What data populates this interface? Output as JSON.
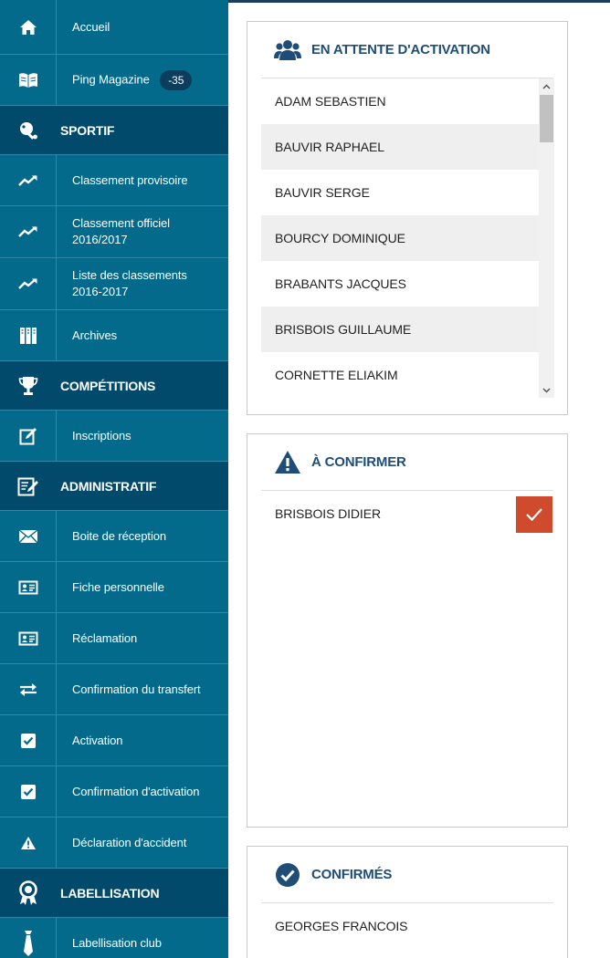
{
  "sidebar": {
    "items": [
      {
        "label": "Accueil",
        "icon": "home-icon"
      },
      {
        "label": "Ping Magazine",
        "badge": "-35",
        "icon": "book-icon"
      },
      {
        "section": "SPORTIF",
        "icon": "pingpong-icon"
      },
      {
        "label": "Classement provisoire",
        "icon": "trend-icon"
      },
      {
        "label": "Classement officiel 2016/2017",
        "icon": "trend-icon"
      },
      {
        "label": "Liste des classements 2016-2017",
        "icon": "trend-icon"
      },
      {
        "label": "Archives",
        "icon": "archive-icon"
      },
      {
        "section": "COMPÉTITIONS",
        "icon": "trophy-icon"
      },
      {
        "label": "Inscriptions",
        "icon": "edit-icon"
      },
      {
        "section": "ADMINISTRATIF",
        "icon": "form-edit-icon"
      },
      {
        "label": "Boite de réception",
        "icon": "envelope-icon"
      },
      {
        "label": "Fiche personnelle",
        "icon": "id-card-icon"
      },
      {
        "label": "Réclamation",
        "icon": "id-card-icon"
      },
      {
        "label": "Confirmation du transfert",
        "icon": "transfer-icon"
      },
      {
        "label": "Activation",
        "icon": "checkbox-icon"
      },
      {
        "label": "Confirmation d'activation",
        "icon": "checkbox-icon"
      },
      {
        "label": "Déclaration d'accident",
        "icon": "warning-icon"
      },
      {
        "section": "LABELLISATION",
        "icon": "award-icon"
      },
      {
        "label": "Labellisation club",
        "icon": "tie-icon"
      }
    ]
  },
  "panels": {
    "pending": {
      "title": "EN ATTENTE D'ACTIVATION",
      "icon": "users-icon",
      "names": [
        "ADAM SEBASTIEN",
        "BAUVIR RAPHAEL",
        "BAUVIR SERGE",
        "BOURCY DOMINIQUE",
        "BRABANTS JACQUES",
        "BRISBOIS GUILLAUME",
        "CORNETTE ELIAKIM"
      ]
    },
    "to_confirm": {
      "title": "À CONFIRMER",
      "icon": "warning-triangle-icon",
      "names": [
        "BRISBOIS DIDIER"
      ]
    },
    "confirmed": {
      "title": "CONFIRMÉS",
      "icon": "check-circle-icon",
      "names": [
        "GEORGES FRANCOIS"
      ]
    }
  },
  "colors": {
    "sidebar_bg": "#046a8c",
    "section_bg": "#024a6b",
    "title_blue": "#1f4d78",
    "confirm_red": "#d04a2e"
  }
}
